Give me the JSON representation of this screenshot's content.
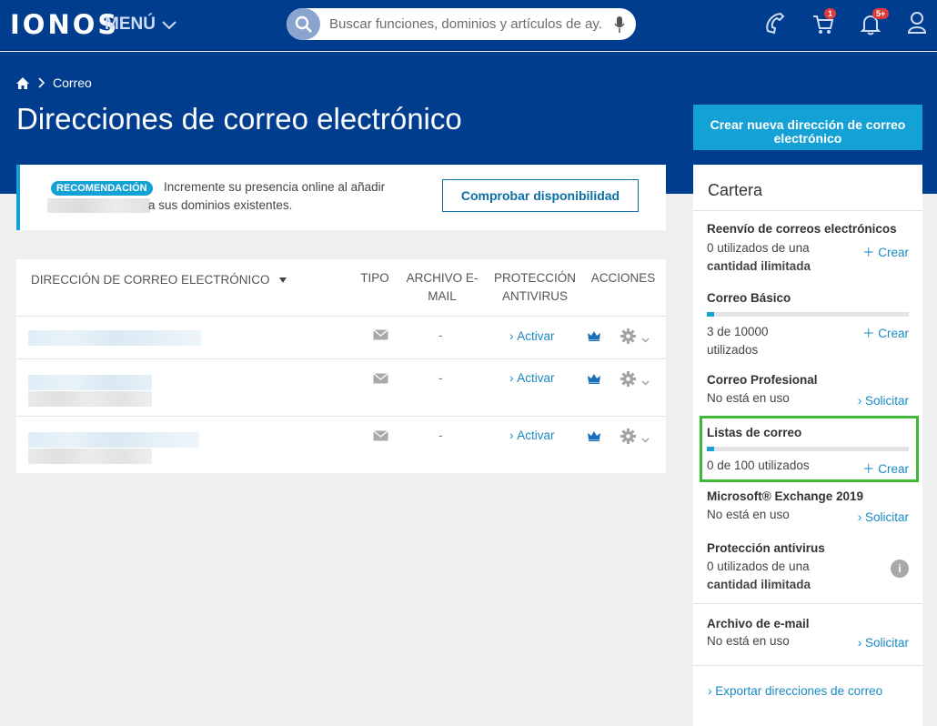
{
  "header": {
    "logo": "IONOS",
    "menu_label": "MENÚ",
    "search_placeholder": "Buscar funciones, dominios y artículos de ay...",
    "cart_badge": "1",
    "notif_badge": "5+"
  },
  "breadcrumb": {
    "current": "Correo"
  },
  "page": {
    "title": "Direcciones de correo electrónico",
    "new_button": "Crear nueva dirección de correo electrónico"
  },
  "recommendation": {
    "tag": "RECOMENDACIÓN",
    "line1": "Incremente su presencia online al añadir",
    "line2": "a sus dominios existentes.",
    "button": "Comprobar disponibilidad"
  },
  "table": {
    "col_address": "DIRECCIÓN DE CORREO ELECTRÓNICO",
    "col_type": "TIPO",
    "col_archive": "ARCHIVO E-MAIL",
    "col_protection": "PROTECCIÓN ANTIVIRUS",
    "col_actions": "ACCIONES",
    "rows": [
      {
        "archive": "-",
        "protection": "Activar"
      },
      {
        "archive": "-",
        "protection": "Activar"
      },
      {
        "archive": "-",
        "protection": "Activar"
      }
    ]
  },
  "sidebar": {
    "title": "Cartera",
    "items": [
      {
        "name": "Reenvío de correos electrónicos",
        "status1": "0 utilizados de una",
        "status2": "cantidad ilimitada",
        "action": "Crear"
      },
      {
        "name": "Correo Básico",
        "status1": "3 de 10000",
        "status2": "utilizados",
        "action": "Crear",
        "usage": 0.0003
      },
      {
        "name": "Correo Profesional",
        "status1": "No está en uso",
        "action": "Solicitar"
      },
      {
        "name": "Listas de correo",
        "status1": "0 de 100 utilizados",
        "action": "Crear",
        "usage": 0
      },
      {
        "name": "Microsoft® Exchange 2019",
        "status1": "No está en uso",
        "action": "Solicitar"
      },
      {
        "name": "Protección antivirus",
        "status1": "0 utilizados de una",
        "status2": "cantidad ilimitada"
      },
      {
        "name": "Archivo de e-mail",
        "status1": "No está en uso",
        "action": "Solicitar"
      }
    ],
    "export": "Exportar direcciones de correo"
  },
  "colors": {
    "brand": "#003d8f",
    "accent": "#14a1d6",
    "highlight": "#3dbb35"
  }
}
